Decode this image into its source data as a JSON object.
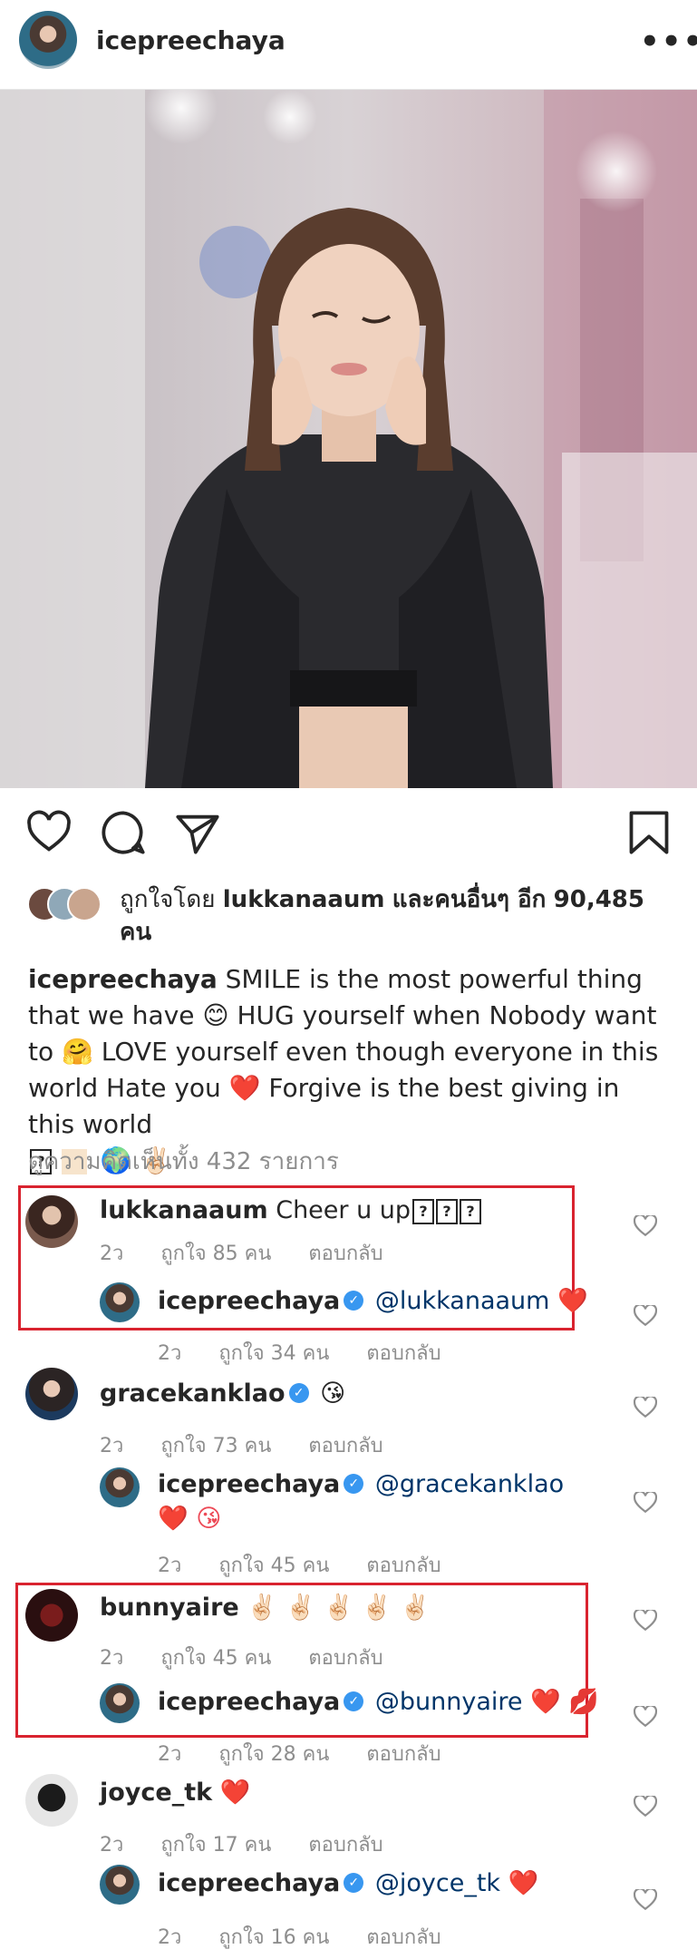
{
  "header": {
    "username": "icepreechaya",
    "more_label": "•••"
  },
  "likes": {
    "prefix": "ถูกใจโดย",
    "user": "lukkanaaum",
    "middle": "และคนอื่นๆ อีก",
    "count": "90,485",
    "suffix": "คน"
  },
  "caption": {
    "user": "icepreechaya",
    "text": "SMILE is the most powerful thing that we have 😊  HUG yourself when Nobody want to 🤗 LOVE yourself even though everyone in this world Hate you ❤️  Forgive is the best giving in this world",
    "tail": "🌍 ✌🏻"
  },
  "view_all": "ดูความคิดเห็นทั้ง 432 รายการ",
  "comments": [
    {
      "user": "lukkanaaum",
      "text": "Cheer u up",
      "time": "2ว",
      "likes": "ถูกใจ 85 คน",
      "reply": "ตอบกลับ",
      "reply_item": {
        "user": "icepreechaya",
        "mention": "@lukkanaaum",
        "text": "❤️",
        "time": "2ว",
        "likes": "ถูกใจ 34 คน",
        "reply": "ตอบกลับ"
      }
    },
    {
      "user": "gracekanklao",
      "text": "😘",
      "time": "2ว",
      "likes": "ถูกใจ 73 คน",
      "reply": "ตอบกลับ",
      "reply_item": {
        "user": "icepreechaya",
        "mention": "@gracekanklao",
        "text": "❤️ 😘",
        "time": "2ว",
        "likes": "ถูกใจ 45 คน",
        "reply": "ตอบกลับ"
      }
    },
    {
      "user": "bunnyaire",
      "text": "✌🏻 ✌🏻 ✌🏻 ✌🏻 ✌🏻",
      "time": "2ว",
      "likes": "ถูกใจ 45 คน",
      "reply": "ตอบกลับ",
      "reply_item": {
        "user": "icepreechaya",
        "mention": "@bunnyaire",
        "text": "❤️ 💋",
        "time": "2ว",
        "likes": "ถูกใจ 28 คน",
        "reply": "ตอบกลับ"
      }
    },
    {
      "user": "joyce_tk",
      "text": "❤️",
      "time": "2ว",
      "likes": "ถูกใจ 17 คน",
      "reply": "ตอบกลับ",
      "reply_item": {
        "user": "icepreechaya",
        "mention": "@joyce_tk",
        "text": "❤️",
        "time": "2ว",
        "likes": "ถูกใจ 16 คน",
        "reply": "ตอบกลับ"
      }
    }
  ],
  "colors": {
    "highlight_box": "#d9232f",
    "verified": "#3897f0",
    "mention": "#003569",
    "heart_red": "#ed4956"
  }
}
